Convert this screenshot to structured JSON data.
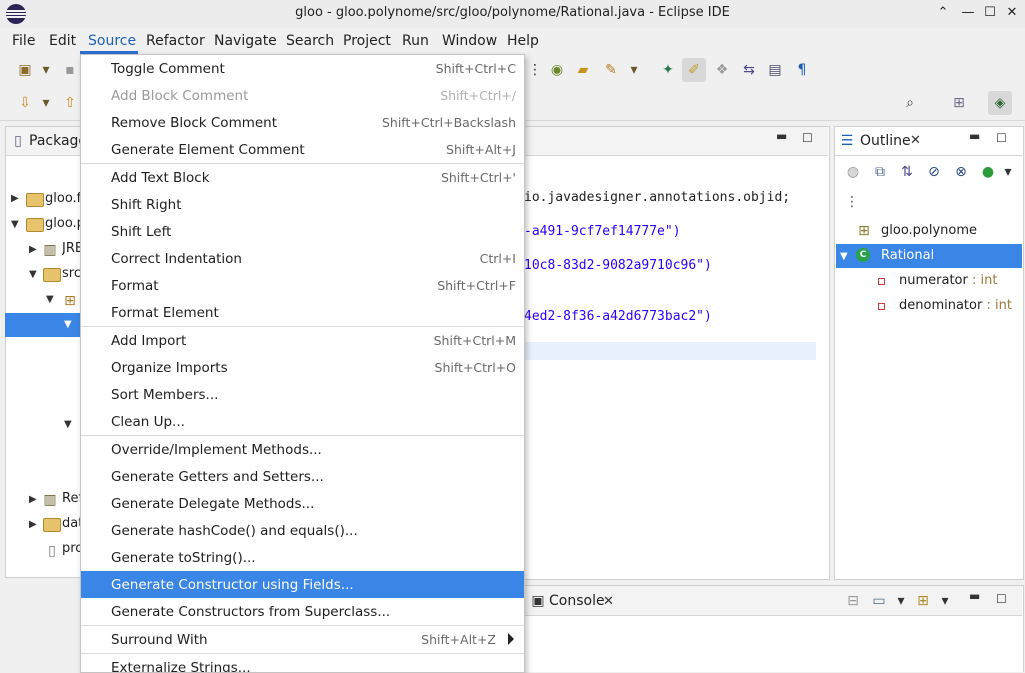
{
  "window": {
    "title": "gloo - gloo.polynome/src/gloo/polynome/Rational.java - Eclipse IDE",
    "controls": [
      "⌃",
      "—",
      "☐",
      "✕"
    ]
  },
  "menubar": {
    "items": [
      "File",
      "Edit",
      "Source",
      "Refactor",
      "Navigate",
      "Search",
      "Project",
      "Run",
      "Window",
      "Help"
    ],
    "active": "Source"
  },
  "package_explorer": {
    "tab_label": "Package",
    "rows": [
      {
        "label": "gloo.f",
        "indent": 0,
        "expanded": false
      },
      {
        "label": "gloo.p",
        "indent": 0,
        "expanded": true
      },
      {
        "label": "JRE",
        "indent": 1,
        "expanded": false
      },
      {
        "label": "src",
        "indent": 1,
        "expanded": true
      },
      {
        "label": "",
        "indent": 2,
        "expanded": true
      },
      {
        "label": "",
        "indent": 3,
        "expanded": true,
        "selected": true
      },
      {
        "label": "",
        "indent": 3,
        "expanded": true
      },
      {
        "label": "Ref",
        "indent": 1,
        "expanded": false
      },
      {
        "label": "dat",
        "indent": 1,
        "expanded": false
      },
      {
        "label": "pro",
        "indent": 1,
        "expanded": false
      }
    ]
  },
  "editor": {
    "lines": [
      {
        "text": "io.javadesigner.annotations.objid;",
        "kind": "plain"
      },
      {
        "text": "-a491-9cf7ef14777e\")",
        "kind": "str"
      },
      {
        "text": "10c8-83d2-9082a9710c96\")",
        "kind": "str"
      },
      {
        "text": "4ed2-8f36-a42d6773bac2\")",
        "kind": "str"
      }
    ]
  },
  "outline": {
    "tab_label": "Outline",
    "items": [
      {
        "label": "gloo.polynome",
        "type": ""
      },
      {
        "label": "Rational",
        "type": "",
        "selected": true
      },
      {
        "label": "numerator",
        "type": " : int"
      },
      {
        "label": "denominator",
        "type": " : int"
      }
    ]
  },
  "console": {
    "tab_label": "Console"
  },
  "source_menu": {
    "items": [
      {
        "label": "Toggle Comment",
        "shortcut": "Shift+Ctrl+C"
      },
      {
        "label": "Add Block Comment",
        "shortcut": "Shift+Ctrl+/",
        "disabled": true
      },
      {
        "label": "Remove Block Comment",
        "shortcut": "Shift+Ctrl+Backslash"
      },
      {
        "label": "Generate Element Comment",
        "shortcut": "Shift+Alt+J"
      },
      {
        "separator": true
      },
      {
        "label": "Add Text Block",
        "shortcut": "Shift+Ctrl+'"
      },
      {
        "label": "Shift Right",
        "shortcut": ""
      },
      {
        "label": "Shift Left",
        "shortcut": ""
      },
      {
        "label": "Correct Indentation",
        "shortcut": "Ctrl+I"
      },
      {
        "label": "Format",
        "shortcut": "Shift+Ctrl+F"
      },
      {
        "label": "Format Element",
        "shortcut": ""
      },
      {
        "separator": true
      },
      {
        "label": "Add Import",
        "shortcut": "Shift+Ctrl+M"
      },
      {
        "label": "Organize Imports",
        "shortcut": "Shift+Ctrl+O"
      },
      {
        "label": "Sort Members...",
        "shortcut": ""
      },
      {
        "label": "Clean Up...",
        "shortcut": ""
      },
      {
        "separator": true
      },
      {
        "label": "Override/Implement Methods...",
        "shortcut": ""
      },
      {
        "label": "Generate Getters and Setters...",
        "shortcut": ""
      },
      {
        "label": "Generate Delegate Methods...",
        "shortcut": ""
      },
      {
        "label": "Generate hashCode() and equals()...",
        "shortcut": ""
      },
      {
        "label": "Generate toString()...",
        "shortcut": ""
      },
      {
        "label": "Generate Constructor using Fields...",
        "shortcut": "",
        "highlighted": true
      },
      {
        "label": "Generate Constructors from Superclass...",
        "shortcut": ""
      },
      {
        "separator": true
      },
      {
        "label": "Surround With",
        "shortcut": "Shift+Alt+Z",
        "submenu": true
      },
      {
        "separator": true
      },
      {
        "label": "Externalize Strings...",
        "shortcut": ""
      }
    ]
  },
  "colors": {
    "selection": "#3a86e6",
    "active_menu_underline": "#2d6fd0",
    "string_literal": "#2a00ff"
  }
}
